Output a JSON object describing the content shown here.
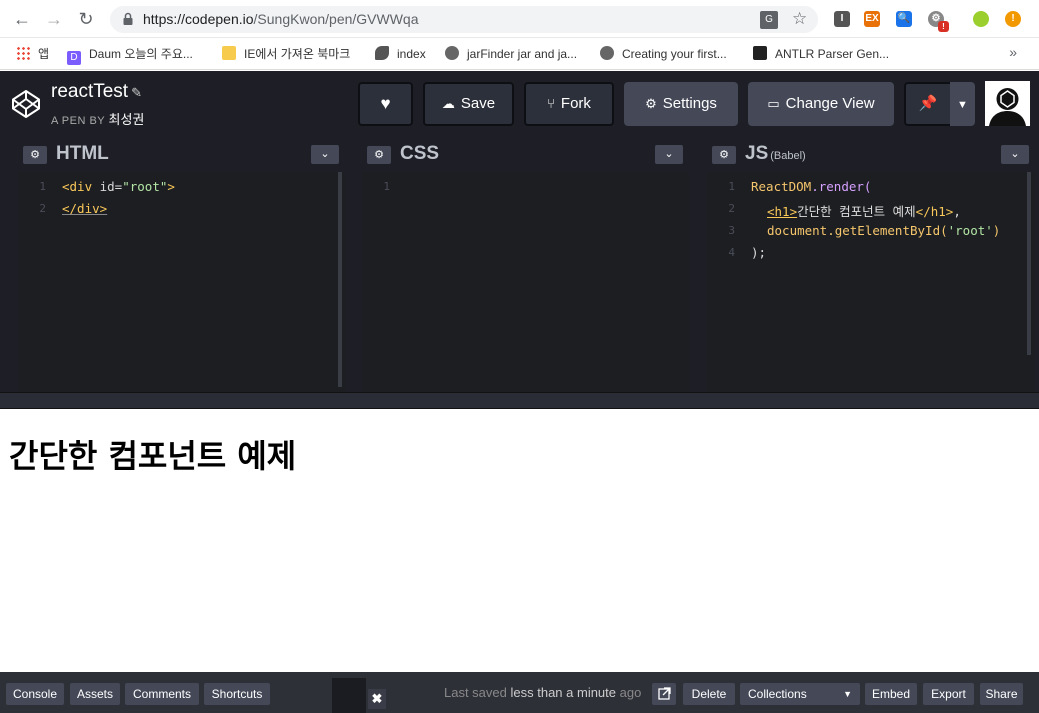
{
  "browser": {
    "url_host": "https://codepen.io",
    "url_path": "/SungKwon/pen/GVWWqa",
    "translate_icon": "translate-icon",
    "bookmarks": [
      {
        "label": "앱",
        "icon": "apps-icon"
      },
      {
        "label": "Daum 오늘의 주요...",
        "icon": "daum-icon"
      },
      {
        "label": "IE에서 가져온 북마크",
        "icon": "folder-icon"
      },
      {
        "label": "index",
        "icon": "bird-icon"
      },
      {
        "label": "jarFinder jar and ja...",
        "icon": "globe-icon"
      },
      {
        "label": "Creating your first...",
        "icon": "globe-icon"
      },
      {
        "label": "ANTLR Parser Gen...",
        "icon": "antlr-icon"
      }
    ],
    "more_bookmarks": "»"
  },
  "header": {
    "pen_title": "reactTest",
    "by_prefix": "A PEN BY",
    "author": "최성권",
    "buttons": {
      "save": "Save",
      "fork": "Fork",
      "settings": "Settings",
      "change_view": "Change View"
    }
  },
  "editors": [
    {
      "lang": "HTML",
      "sub": "",
      "lines": [
        "1",
        "2"
      ]
    },
    {
      "lang": "CSS",
      "sub": "",
      "lines": [
        "1"
      ]
    },
    {
      "lang": "JS",
      "sub": "(Babel)",
      "lines": [
        "1",
        "2",
        "3",
        "4"
      ]
    }
  ],
  "code": {
    "html_div_open": "<div",
    "html_id_attr": " id=",
    "html_id_val": "\"root\"",
    "html_gt": ">",
    "html_div_close": "</div>",
    "js_l1_obj": "ReactDOM",
    "js_l1_rest": ".render(",
    "js_l2_open": "<h1>",
    "js_l2_text": "간단한 컴포넌트 예제",
    "js_l2_close": "</h1>",
    "js_l2_end": ",",
    "js_l3_fn": "document.getElementById(",
    "js_l3_arg": "'root'",
    "js_l3_end": ")",
    "js_l4": ");"
  },
  "preview": {
    "heading": "간단한 컴포넌트 예제"
  },
  "footer": {
    "console": "Console",
    "assets": "Assets",
    "comments": "Comments",
    "shortcuts": "Shortcuts",
    "close": "✖",
    "saved_prefix": "Last saved",
    "saved_time": "less than a minute",
    "saved_suffix": "ago",
    "delete": "Delete",
    "collections": "Collections",
    "embed": "Embed",
    "export": "Export",
    "share": "Share"
  },
  "colors": {
    "editor_bg": "#1d1e22",
    "header_bg": "#1e1f26",
    "button_bg": "#444857",
    "tag": "#f9c859"
  }
}
